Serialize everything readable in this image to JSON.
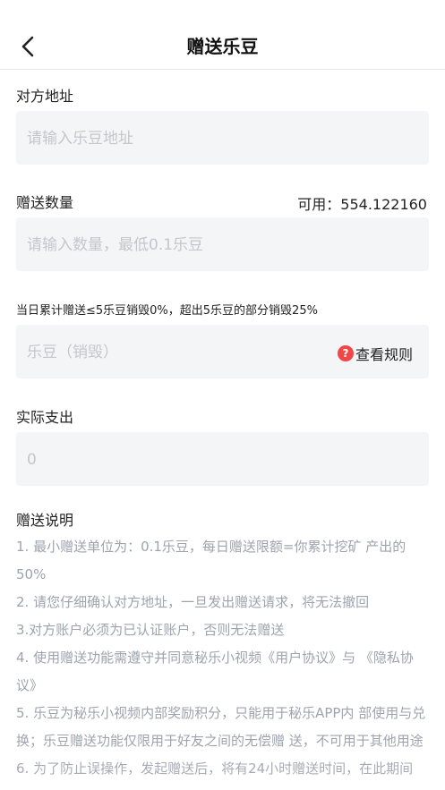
{
  "header": {
    "title": "赠送乐豆"
  },
  "address": {
    "label": "对方地址",
    "placeholder": "请输入乐豆地址"
  },
  "quantity": {
    "label": "赠送数量",
    "available": "可用：554.122160",
    "placeholder": "请输入数量，最低0.1乐豆"
  },
  "burn": {
    "rule_text": "当日累计赠送≤5乐豆销毁0%，超出5乐豆的部分销毁25%",
    "placeholder": "乐豆（销毁）",
    "rules_link": "查看规则",
    "rules_icon": "?"
  },
  "actual": {
    "label": "实际支出",
    "placeholder": "0"
  },
  "instructions": {
    "title": "赠送说明",
    "items": [
      "1. 最小赠送单位为：0.1乐豆，每日赠送限额=你累计挖矿 产出的50%",
      "2. 请您仔细确认对方地址，一旦发出赠送请求，将无法撤回",
      "3.对方账户必须为已认证账户，否则无法赠送",
      "4. 使用赠送功能需遵守并同意秘乐小视频《用户协议》与 《隐私协议》",
      "5. 乐豆为秘乐小视频内部奖励积分，只能用于秘乐APP内 部使用与兑换；乐豆赠送功能仅限用于好友之间的无偿赠 送，不可用于其他用途",
      "6. 为了防止误操作，发起赠送后，将有24小时赠送时间，在此期间"
    ]
  },
  "colors": {
    "placeholder": "#c4c6cb",
    "field_bg": "#f4f5f7",
    "hint_text": "#9ea3ae",
    "rules_icon": "#f24646"
  }
}
